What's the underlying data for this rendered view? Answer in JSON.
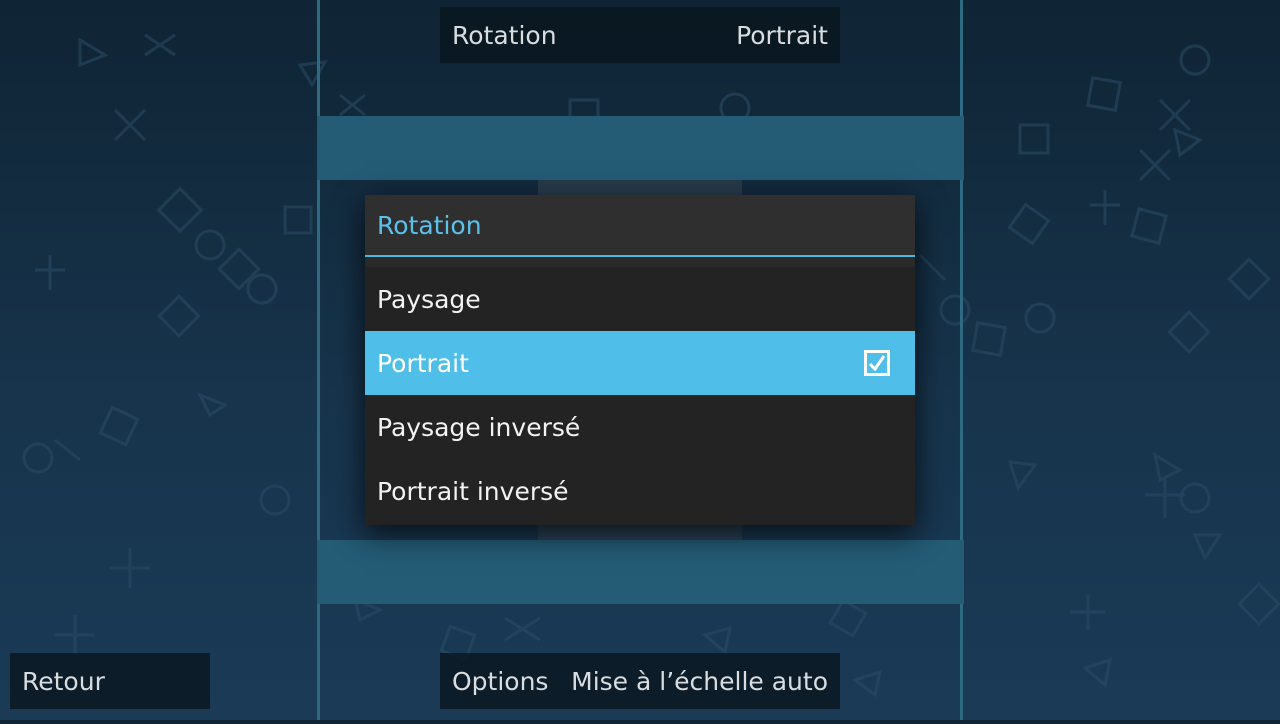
{
  "top_bar": {
    "label": "Rotation",
    "value": "Portrait"
  },
  "dialog": {
    "title": "Rotation",
    "options": [
      {
        "label": "Paysage",
        "selected": false
      },
      {
        "label": "Portrait",
        "selected": true
      },
      {
        "label": "Paysage inversé",
        "selected": false
      },
      {
        "label": "Portrait inversé",
        "selected": false
      }
    ]
  },
  "bottom_bar": {
    "back_label": "Retour",
    "options_label": "Options",
    "autoscale_label": "Mise à l’échelle auto"
  },
  "colors": {
    "accent": "#4fbfea",
    "dialog_bg": "#232323",
    "band": "#245b75",
    "background_top": "#0f2434",
    "background_bottom": "#1a3a56"
  },
  "icons": {
    "checkbox": "checked-checkbox-icon",
    "background": "psp-symbols-pattern"
  }
}
